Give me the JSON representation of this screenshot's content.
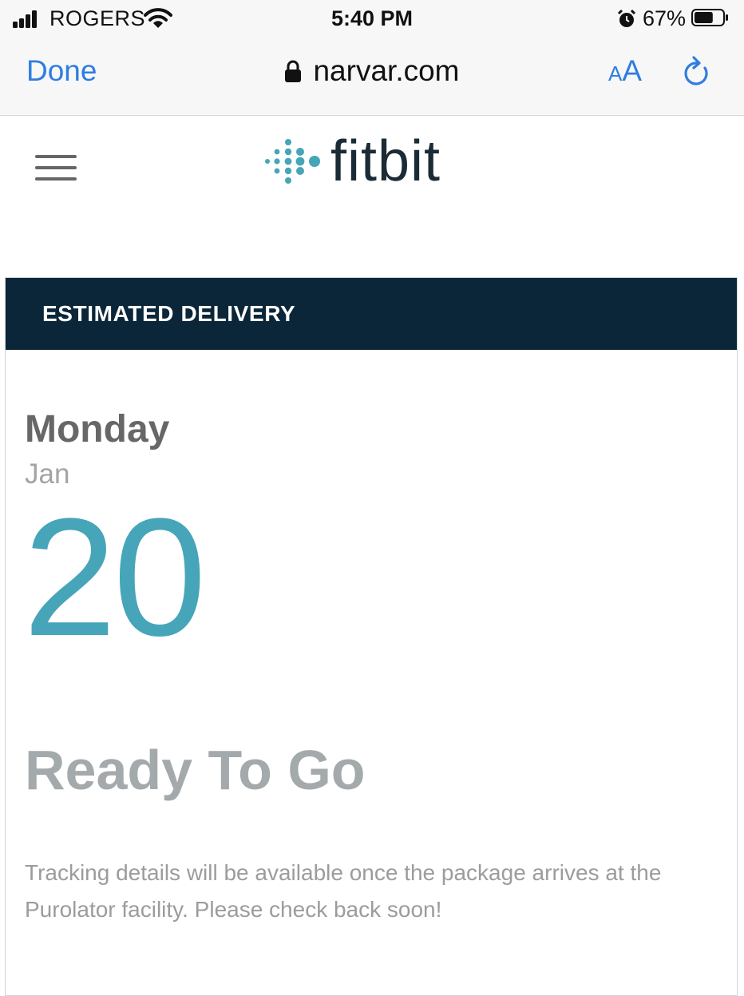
{
  "status_bar": {
    "carrier": "ROGERS",
    "time": "5:40 PM",
    "battery_percent": "67%",
    "signal_icon": "signal-bars-icon",
    "wifi_icon": "wifi-icon",
    "alarm_icon": "alarm-clock-icon",
    "battery_icon": "battery-icon",
    "battery_level": 0.67
  },
  "browser": {
    "done_label": "Done",
    "url": "narvar.com",
    "lock_icon": "lock-icon",
    "text_size_small": "A",
    "text_size_large": "A",
    "reload_icon": "reload-icon",
    "accent_color": "#2f7de1"
  },
  "site_header": {
    "menu_icon": "hamburger-menu-icon",
    "logo_text": "fitbit",
    "logo_color": "#46a5b8"
  },
  "delivery": {
    "header_title": "ESTIMATED DELIVERY",
    "header_bg": "#0b2638",
    "weekday": "Monday",
    "month": "Jan",
    "day": "20",
    "day_color": "#46a5b8",
    "status_title": "Ready To Go",
    "status_description": "Tracking details will be available once the package arrives at the Purolator facility. Please check back soon!"
  }
}
